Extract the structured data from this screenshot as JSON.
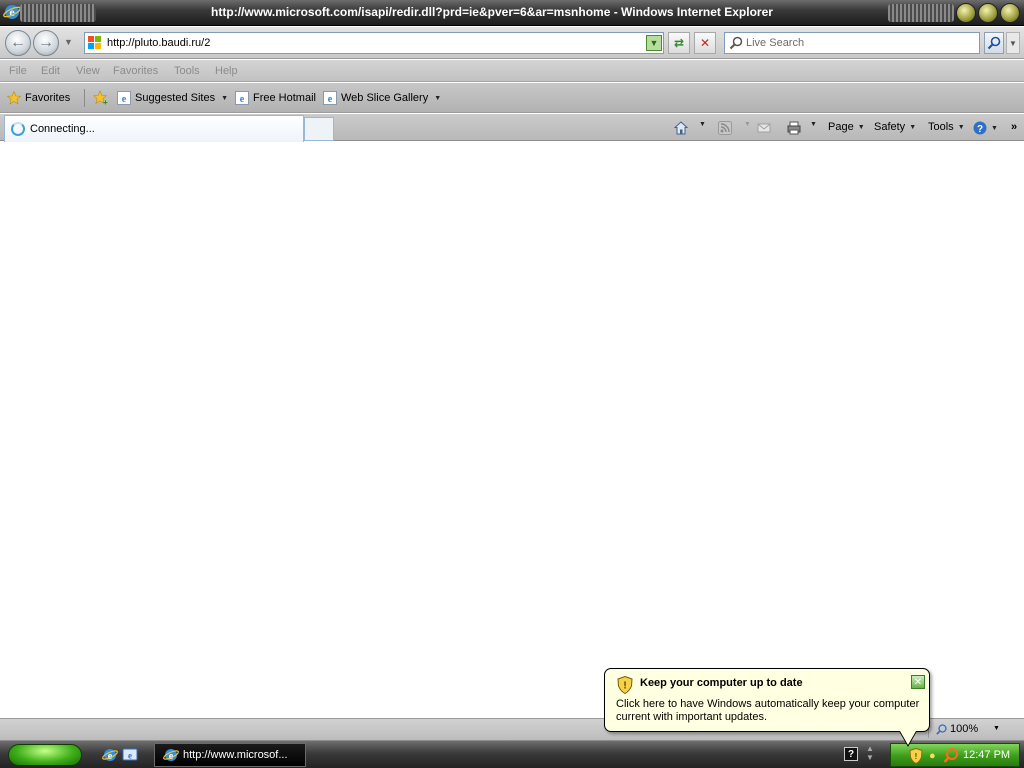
{
  "window": {
    "title": "http://www.microsoft.com/isapi/redir.dll?prd=ie&pver=6&ar=msnhome - Windows Internet Explorer"
  },
  "navbar": {
    "address_value": "http://pluto.baudi.ru/2",
    "search_placeholder": "Live Search"
  },
  "menubar": {
    "items": [
      {
        "label": "File"
      },
      {
        "label": "Edit"
      },
      {
        "label": "View"
      },
      {
        "label": "Favorites"
      },
      {
        "label": "Tools"
      },
      {
        "label": "Help"
      }
    ]
  },
  "favorites_bar": {
    "favorites_label": "Favorites",
    "items": [
      {
        "label": "Suggested Sites"
      },
      {
        "label": "Free Hotmail"
      },
      {
        "label": "Web Slice Gallery"
      }
    ]
  },
  "tab": {
    "label": "Connecting..."
  },
  "command_bar": {
    "page": "Page",
    "safety": "Safety",
    "tools": "Tools",
    "more": "»"
  },
  "status_bar": {
    "zoom": "100%"
  },
  "taskbar": {
    "task_label": "http://www.microsof...",
    "clock": "12:47 PM",
    "help_glyph": "?"
  },
  "balloon": {
    "title": "Keep your computer up to date",
    "body": "Click here to have Windows automatically keep your computer current with important updates."
  },
  "colors": {
    "taskbar_tray": "#3b9d1a",
    "balloon_bg": "#ffffe1",
    "start_button": "#3fb01a"
  },
  "icons": [
    "ie-icon",
    "back-icon",
    "forward-icon",
    "refresh-icon",
    "stop-icon",
    "search-icon",
    "star-icon",
    "home-icon",
    "feed-icon",
    "mail-icon",
    "print-icon",
    "help-icon",
    "shield-icon",
    "close-icon"
  ]
}
